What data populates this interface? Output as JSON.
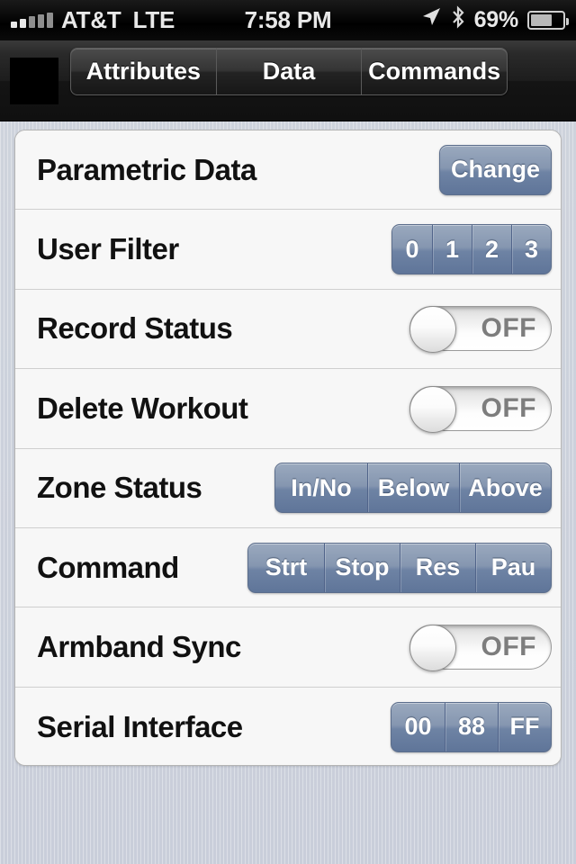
{
  "statusbar": {
    "carrier": "AT&T",
    "network": "LTE",
    "time": "7:58 PM",
    "battery_percent": "69%",
    "battery_level": 69,
    "signal_bars_filled": 2,
    "signal_bars_total": 5,
    "location_icon": "location-arrow-icon",
    "bluetooth_icon": "bluetooth-icon",
    "battery_icon": "battery-icon"
  },
  "navbar": {
    "logo": "app-logo",
    "tabs": [
      {
        "label": "Attributes",
        "selected": false
      },
      {
        "label": "Data",
        "selected": false
      },
      {
        "label": "Commands",
        "selected": false
      }
    ]
  },
  "rows": [
    {
      "label": "Parametric Data",
      "control": "button",
      "name": "change-button",
      "options": [
        "Change"
      ]
    },
    {
      "label": "User Filter",
      "control": "segmented",
      "name": "user-filter-segmented",
      "options": [
        "0",
        "1",
        "2",
        "3"
      ]
    },
    {
      "label": "Record Status",
      "control": "toggle",
      "name": "record-status-toggle",
      "value": "OFF"
    },
    {
      "label": "Delete Workout",
      "control": "toggle",
      "name": "delete-workout-toggle",
      "value": "OFF"
    },
    {
      "label": "Zone Status",
      "control": "segmented",
      "name": "zone-status-segmented",
      "options": [
        "In/No",
        "Below",
        "Above"
      ]
    },
    {
      "label": "Command",
      "control": "segmented",
      "name": "command-segmented",
      "options": [
        "Strt",
        "Stop",
        "Res",
        "Pau"
      ]
    },
    {
      "label": "Armband Sync",
      "control": "toggle",
      "name": "armband-sync-toggle",
      "value": "OFF"
    },
    {
      "label": "Serial Interface",
      "control": "segmented",
      "name": "serial-interface-segmented",
      "options": [
        "00",
        "88",
        "FF"
      ]
    }
  ],
  "colors": {
    "accent_blue": "#6e83a4",
    "accent_blue_light": "#9aa9be",
    "page_background": "#ccd1da",
    "card_background": "#f7f7f7",
    "navbar_background": "#1d1d1d",
    "toggle_off_text": "#7d7d7d"
  }
}
